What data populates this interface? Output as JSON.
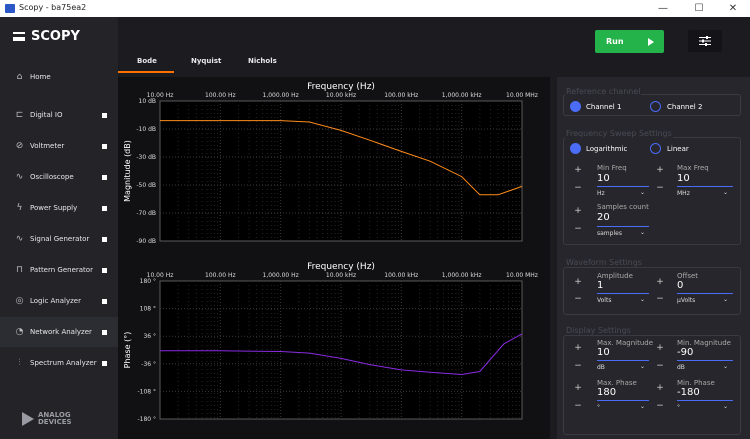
{
  "window": {
    "title": "Scopy - ba75ea2",
    "minimize": "—",
    "maximize": "☐",
    "close": "✕"
  },
  "sidebar": {
    "brand": "SCOPY",
    "items": [
      {
        "label": "Home",
        "icon": "home-icon",
        "glyph": "⌂",
        "indicator": false
      },
      {
        "label": "Digital IO",
        "icon": "digital-io-icon",
        "glyph": "⊏",
        "indicator": true
      },
      {
        "label": "Voltmeter",
        "icon": "voltmeter-icon",
        "glyph": "⊘",
        "indicator": true
      },
      {
        "label": "Oscilloscope",
        "icon": "oscilloscope-icon",
        "glyph": "∿",
        "indicator": true
      },
      {
        "label": "Power Supply",
        "icon": "power-supply-icon",
        "glyph": "ϟ",
        "indicator": true
      },
      {
        "label": "Signal Generator",
        "icon": "signal-generator-icon",
        "glyph": "∿",
        "indicator": true
      },
      {
        "label": "Pattern Generator",
        "icon": "pattern-generator-icon",
        "glyph": "⊓",
        "indicator": true
      },
      {
        "label": "Logic Analyzer",
        "icon": "logic-analyzer-icon",
        "glyph": "◎",
        "indicator": true
      },
      {
        "label": "Network Analyzer",
        "icon": "network-analyzer-icon",
        "glyph": "◔",
        "indicator": true
      },
      {
        "label": "Spectrum Analyzer",
        "icon": "spectrum-analyzer-icon",
        "glyph": "⫶",
        "indicator": true
      }
    ],
    "logo_line1": "ANALOG",
    "logo_line2": "DEVICES"
  },
  "tabs": [
    {
      "label": "Bode"
    },
    {
      "label": "Nyquist"
    },
    {
      "label": "Nichols"
    }
  ],
  "toolbar": {
    "run_label": "Run"
  },
  "colors": {
    "accent": "#ff7200",
    "run": "#24b24a",
    "magnitude_trace": "#ff8c1a",
    "phase_trace": "#8a2be2",
    "radio": "#4a6cf7"
  },
  "chart_data": [
    {
      "type": "line",
      "title": "Frequency (Hz)",
      "ylabel": "Magnitude (dB)",
      "x_ticks": [
        "10.00 Hz",
        "100.00 Hz",
        "1,000.00 Hz",
        "10.00 kHz",
        "100.00 kHz",
        "1,000.00 kHz",
        "10.00 MHz"
      ],
      "y_ticks": [
        "10 dB",
        "-10 dB",
        "-30 dB",
        "-50 dB",
        "-70 dB",
        "-90 dB"
      ],
      "xlim_decades": [
        1,
        7
      ],
      "ylim": [
        -90,
        10
      ],
      "x_scale": "log",
      "grid": true,
      "series": [
        {
          "x_hz": [
            10,
            100,
            1000,
            3000,
            10000,
            30000,
            100000,
            300000,
            1000000,
            2000000,
            4000000,
            10000000
          ],
          "y": [
            -4,
            -4,
            -4,
            -5,
            -11,
            -18,
            -26,
            -33,
            -44,
            -57,
            -57,
            -51
          ]
        }
      ]
    },
    {
      "type": "line",
      "title": "Frequency (Hz)",
      "ylabel": "Phase (°)",
      "x_ticks": [
        "10.00 Hz",
        "100.00 Hz",
        "1,000.00 Hz",
        "10.00 kHz",
        "100.00 kHz",
        "1,000.00 kHz",
        "10.00 MHz"
      ],
      "y_ticks": [
        "180 °",
        "108 °",
        "36 °",
        "-36 °",
        "-108 °",
        "-180 °"
      ],
      "xlim_decades": [
        1,
        7
      ],
      "ylim": [
        -180,
        180
      ],
      "x_scale": "log",
      "grid": true,
      "series": [
        {
          "x_hz": [
            10,
            100,
            1000,
            3000,
            10000,
            30000,
            100000,
            300000,
            1000000,
            2000000,
            5000000,
            10000000
          ],
          "y": [
            -2,
            -2,
            -4,
            -8,
            -22,
            -38,
            -52,
            -58,
            -64,
            -56,
            16,
            42
          ]
        }
      ]
    }
  ],
  "settings": {
    "reference_channel": {
      "title": "Reference channel",
      "channel1": "Channel 1",
      "channel2": "Channel 2"
    },
    "sweep": {
      "title": "Frequency Sweep Settings",
      "logarithmic": "Logarithmic",
      "linear": "Linear",
      "min_freq_label": "Min Freq",
      "min_freq_value": "10",
      "min_freq_unit": "Hz",
      "max_freq_label": "Max Freq",
      "max_freq_value": "10",
      "max_freq_unit": "MHz",
      "samples_label": "Samples count",
      "samples_value": "20",
      "samples_unit": "samples"
    },
    "waveform": {
      "title": "Waveform Settings",
      "amplitude_label": "Amplitude",
      "amplitude_value": "1",
      "amplitude_unit": "Volts",
      "offset_label": "Offset",
      "offset_value": "0",
      "offset_unit": "µVolts"
    },
    "display": {
      "title": "Display Settings",
      "max_mag_label": "Max. Magnitude",
      "max_mag_value": "10",
      "max_mag_unit": "dB",
      "min_mag_label": "Min. Magnitude",
      "min_mag_value": "-90",
      "min_mag_unit": "dB",
      "max_phase_label": "Max. Phase",
      "max_phase_value": "180",
      "max_phase_unit": "°",
      "min_phase_label": "Min. Phase",
      "min_phase_value": "-180",
      "min_phase_unit": "°"
    },
    "plus": "+",
    "minus": "−",
    "caret": "⌄"
  }
}
